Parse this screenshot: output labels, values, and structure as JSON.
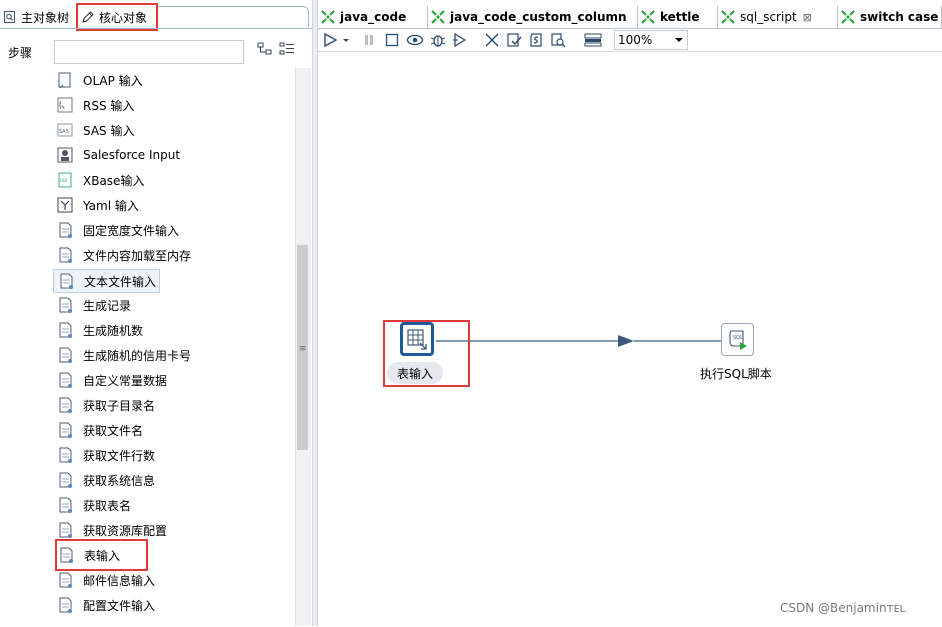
{
  "left_panel": {
    "tabs": {
      "main_tree": "主对象树",
      "core_objects": "核心对象"
    },
    "steps_label": "步骤",
    "search_value": "",
    "items": [
      {
        "label": "OLAP 输入",
        "icon": "olap-input-icon"
      },
      {
        "label": "RSS 输入",
        "icon": "rss-input-icon"
      },
      {
        "label": "SAS 输入",
        "icon": "sas-input-icon"
      },
      {
        "label": "Salesforce Input",
        "icon": "salesforce-input-icon"
      },
      {
        "label": "XBase输入",
        "icon": "xbase-input-icon"
      },
      {
        "label": "Yaml 输入",
        "icon": "yaml-input-icon"
      },
      {
        "label": "固定宽度文件输入",
        "icon": "fixed-width-file-icon"
      },
      {
        "label": "文件内容加载至内存",
        "icon": "load-file-content-icon"
      },
      {
        "label": "文本文件输入",
        "icon": "text-file-input-icon"
      },
      {
        "label": "生成记录",
        "icon": "generate-rows-icon"
      },
      {
        "label": "生成随机数",
        "icon": "random-value-icon"
      },
      {
        "label": "生成随机的信用卡号",
        "icon": "random-ccnumber-icon"
      },
      {
        "label": "自定义常量数据",
        "icon": "data-grid-icon"
      },
      {
        "label": "获取子目录名",
        "icon": "get-subfolders-icon"
      },
      {
        "label": "获取文件名",
        "icon": "get-filenames-icon"
      },
      {
        "label": "获取文件行数",
        "icon": "get-files-rowcount-icon"
      },
      {
        "label": "获取系统信息",
        "icon": "system-info-icon"
      },
      {
        "label": "获取表名",
        "icon": "get-table-names-icon"
      },
      {
        "label": "获取资源库配置",
        "icon": "get-repository-names-icon"
      },
      {
        "label": "表输入",
        "icon": "table-input-icon"
      },
      {
        "label": "邮件信息输入",
        "icon": "mail-input-icon"
      },
      {
        "label": "配置文件输入",
        "icon": "property-input-icon"
      }
    ],
    "selected_item": "文本文件输入",
    "highlighted_item": "表输入"
  },
  "editor_tabs": [
    {
      "label": "java_code",
      "active": false
    },
    {
      "label": "java_code_custom_column",
      "active": false
    },
    {
      "label": "kettle",
      "active": false
    },
    {
      "label": "sql_script",
      "active": true,
      "close": "⊠"
    },
    {
      "label": "switch case",
      "active": false
    }
  ],
  "toolbar": {
    "zoom": "100%"
  },
  "canvas": {
    "nodes": [
      {
        "label": "表输入",
        "icon": "table-input-icon"
      },
      {
        "label": "执行SQL脚本",
        "icon": "exec-sql-icon"
      }
    ]
  },
  "watermark": "CSDN @Benjaminᴛᴇʟ",
  "colors": {
    "highlight": "#e03a3a",
    "node_border": "#1f5a96",
    "hop": "#3d5a7a",
    "tab_icon_green": "#2aa33a"
  }
}
